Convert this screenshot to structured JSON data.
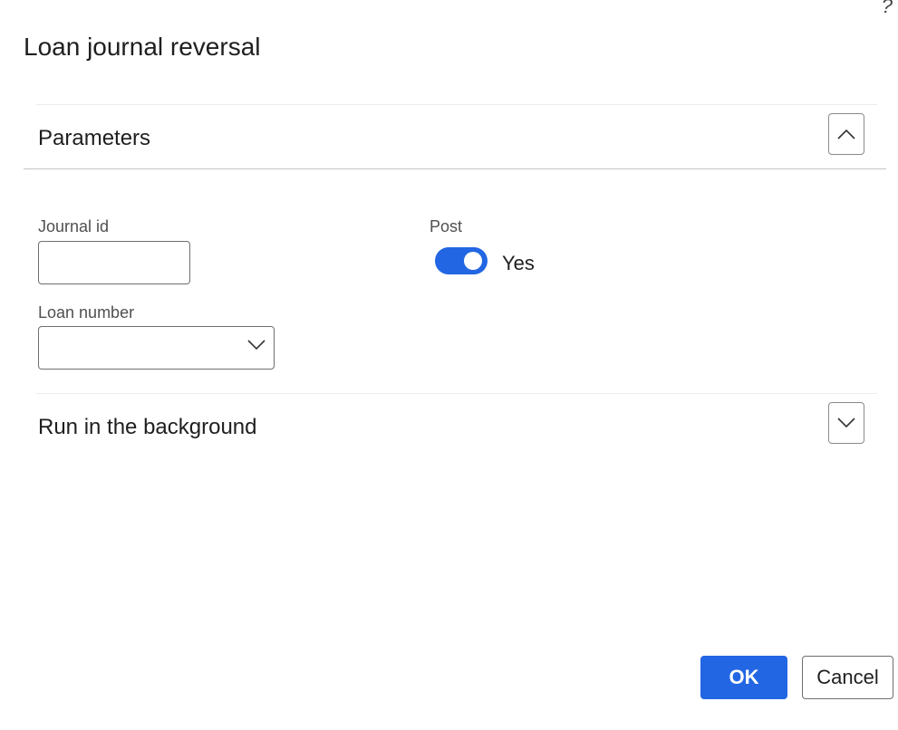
{
  "dialog": {
    "title": "Loan journal reversal",
    "help_glyph": "?"
  },
  "parameters": {
    "header": "Parameters",
    "expanded": true,
    "journal_id": {
      "label": "Journal id",
      "value": ""
    },
    "loan_number": {
      "label": "Loan number",
      "value": ""
    },
    "post": {
      "label": "Post",
      "state_text": "Yes",
      "on": true
    }
  },
  "background": {
    "header": "Run in the background",
    "expanded": false
  },
  "footer": {
    "ok_label": "OK",
    "cancel_label": "Cancel"
  },
  "colors": {
    "accent": "#2266e3",
    "text": "#1f1f1f",
    "label": "#505050",
    "border": "#6e6e6e"
  },
  "icons": {
    "help": "question-mark-icon",
    "collapse": "chevron-up-icon",
    "expand": "chevron-down-icon",
    "dropdown": "chevron-down-icon"
  }
}
